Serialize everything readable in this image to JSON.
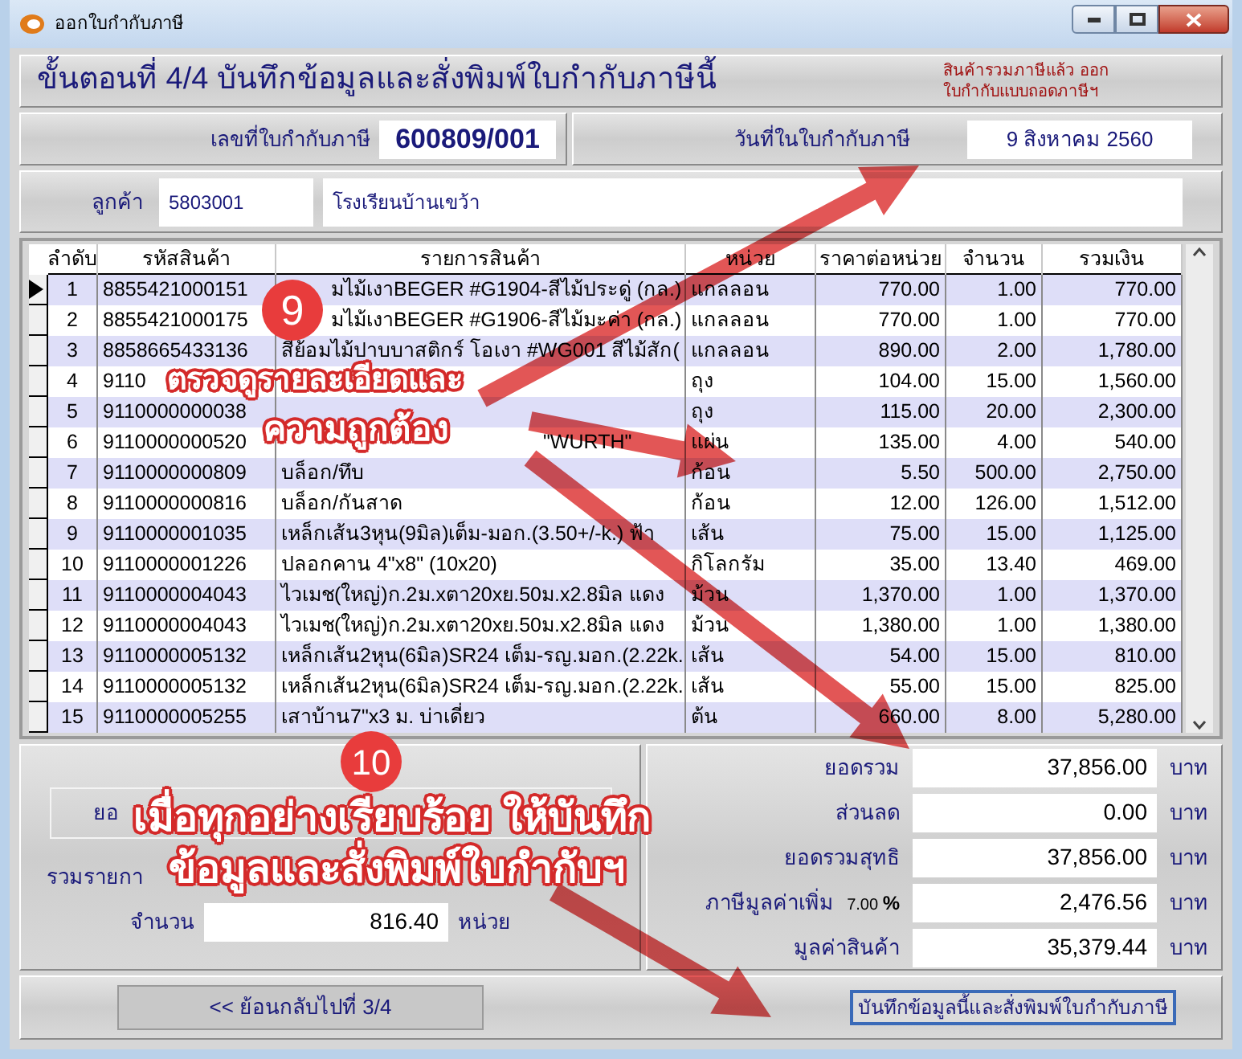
{
  "window": {
    "title": "ออกใบกำกับภาษี"
  },
  "header": {
    "title": "ขั้นตอนที่ 4/4 บันทึกข้อมูลและสั่งพิมพ์ใบกำกับภาษีนี้",
    "note_lines": [
      "สินค้ารวมภาษีแล้ว ออก",
      "ใบกำกับแบบถอดภาษีฯ"
    ]
  },
  "invoice": {
    "number_label": "เลขที่ใบกำกับภาษี",
    "number": "600809/001",
    "date_label": "วันที่ในใบกำกับภาษี",
    "date": "9 สิงหาคม 2560"
  },
  "customer": {
    "label": "ลูกค้า",
    "code": "5803001",
    "name": "โรงเรียนบ้านเขว้า"
  },
  "table": {
    "columns": [
      "ลำดับ",
      "รหัสสินค้า",
      "รายการสินค้า",
      "หน่วย",
      "ราคาต่อหน่วย",
      "จำนวน",
      "รวมเงิน"
    ],
    "rows": [
      {
        "selected": true,
        "cells": [
          "1",
          "8855421000151",
          "มไม้เงาBEGER #G1904-สีไม้ประดู่ (กล.)",
          "แกลลอน",
          "770.00",
          "1.00",
          "770.00"
        ]
      },
      {
        "selected": false,
        "cells": [
          "2",
          "8855421000175",
          "มไม้เงาBEGER #G1906-สีไม้มะค่า (กล.)",
          "แกลลอน",
          "770.00",
          "1.00",
          "770.00"
        ]
      },
      {
        "selected": false,
        "cells": [
          "3",
          "8858665433136",
          "สีย้อมไม้ปาบบาสติกร์ โอเงา #WG001 สีไม้สัก(",
          "แกลลอน",
          "890.00",
          "2.00",
          "1,780.00"
        ]
      },
      {
        "selected": false,
        "cells": [
          "4",
          "9110",
          null,
          "ถุง",
          "104.00",
          "15.00",
          "1,560.00"
        ]
      },
      {
        "selected": false,
        "cells": [
          "5",
          "9110000000038",
          null,
          "ถุง",
          "115.00",
          "20.00",
          "2,300.00"
        ]
      },
      {
        "selected": false,
        "cells": [
          "6",
          "9110000000520",
          "\"WURTH\"",
          "แผ่น",
          "135.00",
          "4.00",
          "540.00"
        ]
      },
      {
        "selected": false,
        "cells": [
          "7",
          "9110000000809",
          "บล็อก/ทึบ",
          "ก้อน",
          "5.50",
          "500.00",
          "2,750.00"
        ]
      },
      {
        "selected": false,
        "cells": [
          "8",
          "9110000000816",
          "บล็อก/กันสาด",
          "ก้อน",
          "12.00",
          "126.00",
          "1,512.00"
        ]
      },
      {
        "selected": false,
        "cells": [
          "9",
          "9110000001035",
          "เหล็กเส้น3หุน(9มิล)เต็ม-มอก.(3.50+/-k.) ฟ้า",
          "เส้น",
          "75.00",
          "15.00",
          "1,125.00"
        ]
      },
      {
        "selected": false,
        "cells": [
          "10",
          "9110000001226",
          "ปลอกคาน 4\"x8\" (10x20)",
          "กิโลกรัม",
          "35.00",
          "13.40",
          "469.00"
        ]
      },
      {
        "selected": false,
        "cells": [
          "11",
          "9110000004043",
          "ไวเมช(ใหญ่)ก.2ม.xตา20xย.50ม.x2.8มิล แดง",
          "ม้วน",
          "1,370.00",
          "1.00",
          "1,370.00"
        ]
      },
      {
        "selected": false,
        "cells": [
          "12",
          "9110000004043",
          "ไวเมช(ใหญ่)ก.2ม.xตา20xย.50ม.x2.8มิล แดง",
          "ม้วน",
          "1,380.00",
          "1.00",
          "1,380.00"
        ]
      },
      {
        "selected": false,
        "cells": [
          "13",
          "9110000005132",
          "เหล็กเส้น2หุน(6มิล)SR24 เต็ม-รญ.มอก.(2.22k.",
          "เส้น",
          "54.00",
          "15.00",
          "810.00"
        ]
      },
      {
        "selected": false,
        "cells": [
          "14",
          "9110000005132",
          "เหล็กเส้น2หุน(6มิล)SR24 เต็ม-รญ.มอก.(2.22k.",
          "เส้น",
          "55.00",
          "15.00",
          "825.00"
        ]
      },
      {
        "selected": false,
        "cells": [
          "15",
          "9110000005255",
          "เสาบ้าน7\"x3 ม. บ่าเดี่ยว",
          "ต้น",
          "660.00",
          "8.00",
          "5,280.00"
        ]
      }
    ]
  },
  "summary_left": {
    "box_label": "ยอ",
    "items_label": "รวมรายกา",
    "quantity_label": "จำนวน",
    "quantity": "816.40",
    "quantity_unit": "หน่วย"
  },
  "totals": [
    {
      "label": "ยอดรวม",
      "value": "37,856.00",
      "unit": "บาท"
    },
    {
      "label": "ส่วนลด",
      "value": "0.00",
      "unit": "บาท"
    },
    {
      "label": "ยอดรวมสุทธิ",
      "value": "37,856.00",
      "unit": "บาท"
    },
    {
      "label": "ภาษีมูลค่าเพิ่ม",
      "rate": "7.00",
      "rate_unit": "%",
      "value": "2,476.56",
      "unit": "บาท"
    },
    {
      "label": "มูลค่าสินค้า",
      "value": "35,379.44",
      "unit": "บาท"
    }
  ],
  "buttons": {
    "back": "<< ย้อนกลับไปที่ 3/4",
    "save": "บันทึกข้อมูลนี้และสั่งพิมพ์ใบกำกับภาษี"
  },
  "annotations": [
    {
      "number": "9",
      "lines": [
        "ตรวจดูรายละเอียดและ",
        "ความถูกต้อง"
      ]
    },
    {
      "number": "10",
      "lines": [
        "เมื่อทุกอย่างเรียบร้อย ให้บันทึก",
        "ข้อมูลและสั่งพิมพ์ใบกำกับฯ"
      ]
    }
  ]
}
